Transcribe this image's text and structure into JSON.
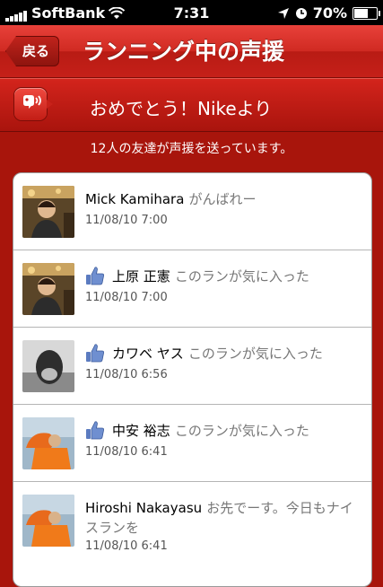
{
  "status_bar": {
    "carrier": "SoftBank",
    "time": "7:31",
    "battery": "70%",
    "battery_level": 0.7,
    "icons": [
      "signal-icon",
      "wifi-icon",
      "location-icon",
      "alarm-icon",
      "battery-icon"
    ]
  },
  "navbar": {
    "back_label": "戻る",
    "title": "ランニング中の声援"
  },
  "banner": {
    "icon": "cheer-icon",
    "text": "おめでとう！Nikeより"
  },
  "summary": "12人の友達が声援を送っています。",
  "items": [
    {
      "name": "Mick Kamihara",
      "message": "がんばれー",
      "date": "11/08/10 7:00",
      "liked": false
    },
    {
      "name": "上原 正憲",
      "message": "このランが気に入った",
      "date": "11/08/10 7:00",
      "liked": true
    },
    {
      "name": "カワベ ヤス",
      "message": "このランが気に入った",
      "date": "11/08/10 6:56",
      "liked": true
    },
    {
      "name": "中安 裕志",
      "message": "このランが気に入った",
      "date": "11/08/10 6:41",
      "liked": true
    },
    {
      "name": "Hiroshi Nakayasu",
      "message": "お先でーす。今日もナイスランを",
      "date": "11/08/10 6:41",
      "liked": false
    }
  ],
  "colors": {
    "accent": "#c52019",
    "background": "#a8150c",
    "like_blue": "#5b7bc0"
  }
}
